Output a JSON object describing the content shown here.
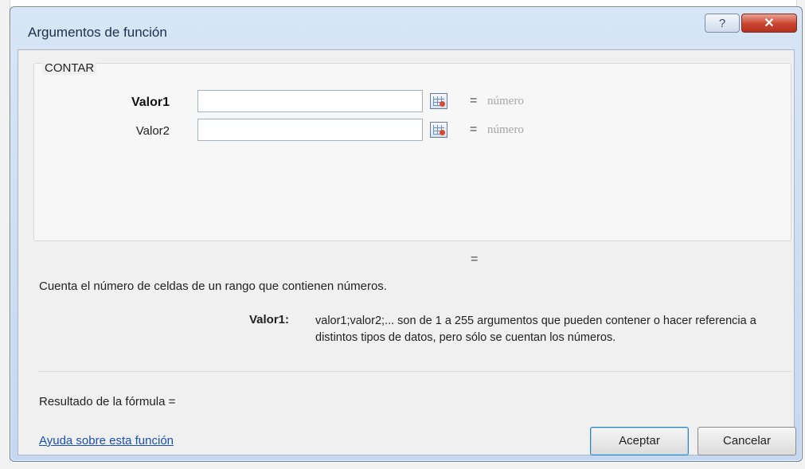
{
  "dialog": {
    "title": "Argumentos de función",
    "help_glyph": "?",
    "close_glyph": "✕"
  },
  "function_group": {
    "name": "CONTAR",
    "arguments": [
      {
        "label": "Valor1",
        "value": "",
        "result_sign": "=",
        "result_text": "número",
        "bold": true
      },
      {
        "label": "Valor2",
        "value": "",
        "result_sign": "=",
        "result_text": "número",
        "bold": false
      }
    ],
    "ref_icon": "range-select-icon"
  },
  "result_sign_overall": "=",
  "description": "Cuenta el número de celdas de un rango que contienen números.",
  "argument_help": {
    "name": "Valor1:",
    "text": "valor1;valor2;... son de 1 a 255 argumentos que pueden contener o hacer referencia a distintos tipos de datos, pero sólo se cuentan los números."
  },
  "formula_result_label": "Resultado de la fórmula =",
  "help_link": "Ayuda sobre esta función",
  "buttons": {
    "ok": "Aceptar",
    "cancel": "Cancelar"
  },
  "colors": {
    "title_gradient_top": "#d7e6f7",
    "close_red": "#c9432f",
    "link_blue": "#1a4fb3"
  }
}
